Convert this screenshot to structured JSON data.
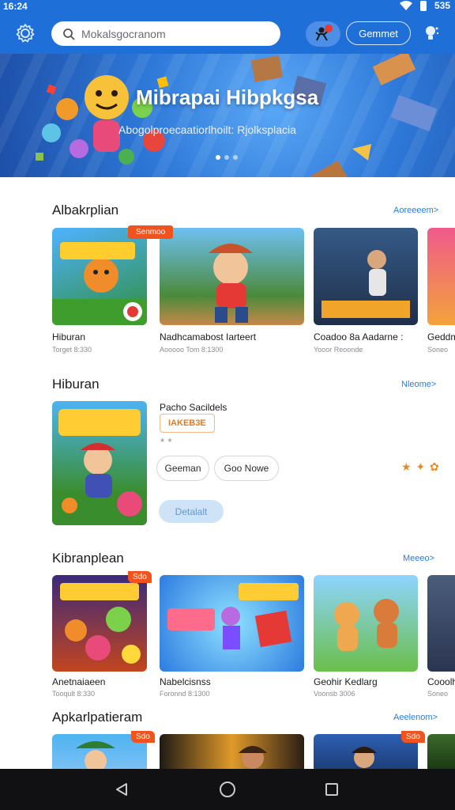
{
  "status_bar": {
    "time": "16:24",
    "battery": "535"
  },
  "header": {
    "search_placeholder": "Mokalsgocranom",
    "game_button": "Gemmet"
  },
  "banner": {
    "title": "Mibrapai Hibpkgsa",
    "subtitle": "Abogolproecaatiorlhoilt: Rjolksplacia"
  },
  "sections": {
    "popular": {
      "title": "Albakrplian",
      "more": "Aoreeeem>",
      "cards": [
        {
          "title": "Hiburan",
          "sub": "Torget 8:330",
          "badge": ""
        },
        {
          "title": "Nadhcamabost Iarteert",
          "sub": "Aooooo Tom 8:1300",
          "badge": "Senmoo"
        },
        {
          "title": "Coadoo 8a Aadarne :",
          "sub": "Yooor Reoonde",
          "badge": ""
        },
        {
          "title": "Geddm",
          "sub": "Soneo",
          "badge": ""
        }
      ]
    },
    "featured": {
      "title": "Hiburan",
      "more": "Nleome>",
      "name": "Pacho Sacildels",
      "tag": "IAKEB3E",
      "rating": "★ ★",
      "btn_game": "Geeman",
      "btn_move": "Goo Nowe",
      "btn_detail": "Detalalt",
      "stars": "★ ✦ ✿"
    },
    "kibrarpian": {
      "title": "Kibranplean",
      "more": "Meeeo>",
      "cards": [
        {
          "title": "Anetnaiaeen",
          "sub": "Tooqult 8:330",
          "badge": "Sdo"
        },
        {
          "title": "Nabelcisnss",
          "sub": "Foronnd 8:1300",
          "badge": ""
        },
        {
          "title": "Geohir Kedlarg",
          "sub": "Voonsb 3006",
          "badge": ""
        },
        {
          "title": "Cooolh",
          "sub": "Soneo",
          "badge": ""
        }
      ]
    },
    "apps": {
      "title": "Apkarlpatieram",
      "more": "Aeelenom>",
      "cards": [
        {
          "badge": "Sdo"
        },
        {
          "badge": ""
        },
        {
          "badge": "Sdo"
        },
        {
          "badge": ""
        }
      ]
    }
  },
  "colors": {
    "brand_blue": "#1f6fd8",
    "accent_orange": "#f0531e",
    "link_blue": "#2c7be5"
  }
}
